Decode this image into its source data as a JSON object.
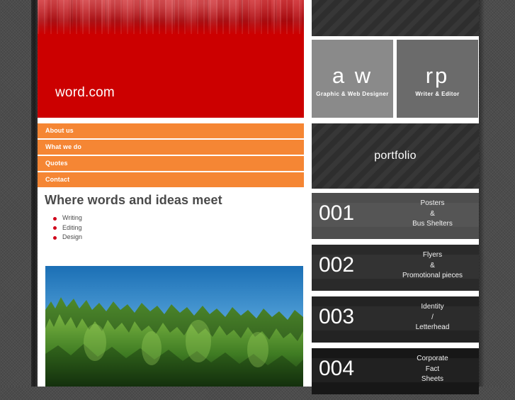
{
  "site": {
    "banner_title": "word.com"
  },
  "nav": {
    "items": [
      {
        "label": "About us"
      },
      {
        "label": "What we do"
      },
      {
        "label": "Quotes"
      },
      {
        "label": "Contact"
      }
    ]
  },
  "main": {
    "heading": "Where words and ideas meet",
    "services": [
      {
        "label": "Writing"
      },
      {
        "label": "Editing"
      },
      {
        "label": "Design"
      }
    ],
    "photo_alt": "Forest treeline under blue sky"
  },
  "profiles": [
    {
      "initials": "a w",
      "role": "Graphic & Web Designer"
    },
    {
      "initials": "rp",
      "role": "Writer & Editor"
    }
  ],
  "portfolio": {
    "title": "portfolio",
    "items": [
      {
        "number": "001",
        "label": "Posters\n&\nBus Shelters"
      },
      {
        "number": "002",
        "label": "Flyers\n&\nPromotional pieces"
      },
      {
        "number": "003",
        "label": "Identity\n/\nLetterhead"
      },
      {
        "number": "004",
        "label": "Corporate\nFact\nSheets"
      }
    ]
  },
  "colors": {
    "brand_red": "#cc0000",
    "nav_orange": "#f58634",
    "bullet_red": "#d0021b",
    "panel_dark": "#303030",
    "page_bg": "#4c4c4c"
  }
}
